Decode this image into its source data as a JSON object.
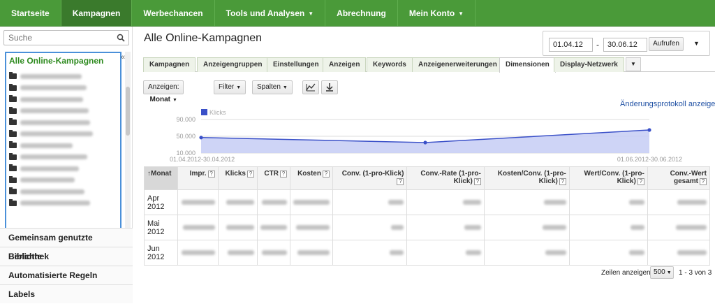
{
  "nav": {
    "items": [
      {
        "label": "Startseite",
        "active": false,
        "dropdown": false
      },
      {
        "label": "Kampagnen",
        "active": true,
        "dropdown": false
      },
      {
        "label": "Werbechancen",
        "active": false,
        "dropdown": false
      },
      {
        "label": "Tools und Analysen",
        "active": false,
        "dropdown": true
      },
      {
        "label": "Abrechnung",
        "active": false,
        "dropdown": false
      },
      {
        "label": "Mein Konto",
        "active": false,
        "dropdown": true
      }
    ],
    "color": "#4a9a39"
  },
  "sidebar": {
    "search_placeholder": "Suche",
    "tree_root": "Alle Online-Kampagnen",
    "campaign_count_visible": 12,
    "links": [
      "Gemeinsam genutzte Bibliothek",
      "Berichte",
      "Automatisierte Regeln",
      "Labels"
    ]
  },
  "main": {
    "title": "Alle Online-Kampagnen",
    "date_from": "01.04.12",
    "date_to": "30.06.12",
    "go_label": "Aufrufen",
    "tabs": [
      "Kampagnen",
      "Anzeigengruppen",
      "Einstellungen",
      "Anzeigen",
      "Keywords",
      "Anzeigenerweiterungen",
      "Dimensionen",
      "Display-Netzwerk"
    ],
    "active_tab": "Dimensionen",
    "toolbar": {
      "view_label": "Anzeigen:",
      "view_value": "Monat",
      "filter_label": "Filter",
      "columns_label": "Spalten"
    },
    "changelog": "Änderungsprotokoll anzeigen"
  },
  "chart_data": {
    "type": "area",
    "series": [
      {
        "name": "Klicks",
        "color": "#3a50c8",
        "x": [
          "01.04.2012-30.04.2012",
          "01.05.2012-31.05.2012",
          "01.06.2012-30.06.2012"
        ],
        "y": [
          47000,
          35000,
          65000
        ]
      }
    ],
    "y_ticks": [
      "90.000",
      "50.000",
      "10.000"
    ],
    "ylim": [
      10000,
      90000
    ],
    "x_start_label": "01.04.2012-30.04.2012",
    "x_end_label": "01.06.2012-30.06.2012",
    "grid": true
  },
  "table": {
    "columns": [
      "Monat",
      "Impr.",
      "Klicks",
      "CTR",
      "Kosten",
      "Conv. (1-pro-Klick)",
      "Conv.-Rate (1-pro-Klick)",
      "Kosten/Conv. (1-pro-Klick)",
      "Wert/Conv. (1-pro-Klick)",
      "Conv.-Wert gesamt"
    ],
    "sort_arrow": "↑",
    "rows": [
      {
        "month": "Apr 2012"
      },
      {
        "month": "Mai 2012"
      },
      {
        "month": "Jun 2012"
      }
    ]
  },
  "footer": {
    "rows_label": "Zeilen anzeigen:",
    "rows_value": "500",
    "range": "1 - 3 von 3"
  }
}
